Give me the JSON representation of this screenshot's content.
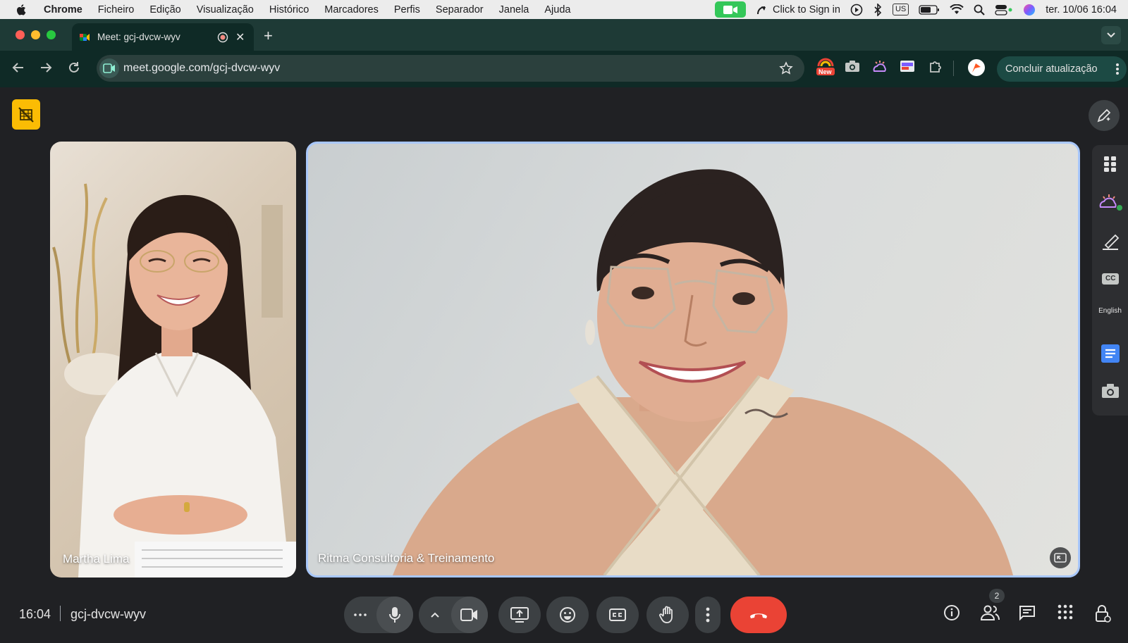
{
  "menubar": {
    "app_name": "Chrome",
    "items": [
      "Ficheiro",
      "Edição",
      "Visualização",
      "Histórico",
      "Marcadores",
      "Perfis",
      "Separador",
      "Janela",
      "Ajuda"
    ],
    "sign_in": "Click to Sign in",
    "input_source": "US",
    "datetime": "ter. 10/06  16:04"
  },
  "tab": {
    "title": "Meet: gcj-dvcw-wyv"
  },
  "toolbar": {
    "url": "meet.google.com/gcj-dvcw-wyv",
    "update_label": "Concluir atualização",
    "ext_new_badge": "New"
  },
  "tiles": {
    "left_name": "Martha Lima",
    "right_name": "Ritma Consultoria & Treinamento"
  },
  "sidepanel": {
    "language": "English",
    "cc_label": "CC"
  },
  "bottombar": {
    "time": "16:04",
    "meeting_code": "gcj-dvcw-wyv",
    "participant_count": "2"
  },
  "colors": {
    "end_call": "#ea4335",
    "active_speaker_border": "#a8c7fa",
    "facetime": "#34c759",
    "badge_yellow": "#fbbc04"
  }
}
